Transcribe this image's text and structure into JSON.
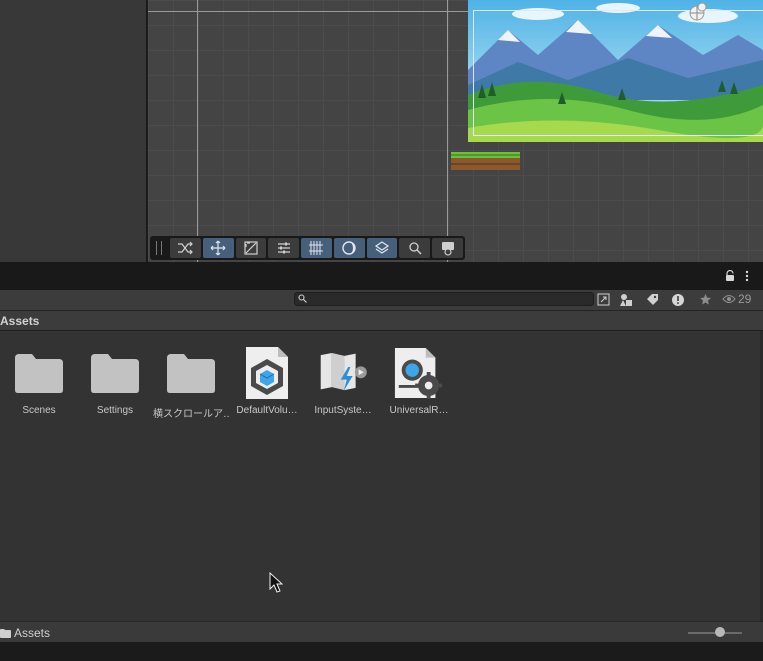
{
  "scene": {
    "toolbar_tools": [
      {
        "name": "shuffle-icon",
        "active": false
      },
      {
        "name": "move-icon",
        "active": true
      },
      {
        "name": "rect-transform-icon",
        "active": false
      },
      {
        "name": "sliders-icon",
        "active": false
      },
      {
        "name": "grid-snap-icon",
        "active": true
      },
      {
        "name": "moon-icon",
        "active": true
      },
      {
        "name": "layers-icon",
        "active": true
      },
      {
        "name": "zoom-icon",
        "active": false
      },
      {
        "name": "scene-camera-icon",
        "active": false
      }
    ]
  },
  "project": {
    "search": {
      "value": "",
      "placeholder": ""
    },
    "hidden_count": "29",
    "breadcrumb": "Assets",
    "items": [
      {
        "label": "Scenes",
        "icon": "folder-icon"
      },
      {
        "label": "Settings",
        "icon": "folder-icon"
      },
      {
        "label": "横スクロールア…",
        "icon": "folder-icon"
      },
      {
        "label": "DefaultVolu…",
        "icon": "volume-profile-icon"
      },
      {
        "label": "InputSyste…",
        "icon": "input-actions-icon"
      },
      {
        "label": "UniversalR…",
        "icon": "render-pipeline-asset-icon"
      }
    ],
    "footer_path": "Assets",
    "zoom_level": 0.6
  },
  "colors": {
    "active_tool": "#46607c",
    "panel": "#333333",
    "folder": "#c2c2c2"
  }
}
